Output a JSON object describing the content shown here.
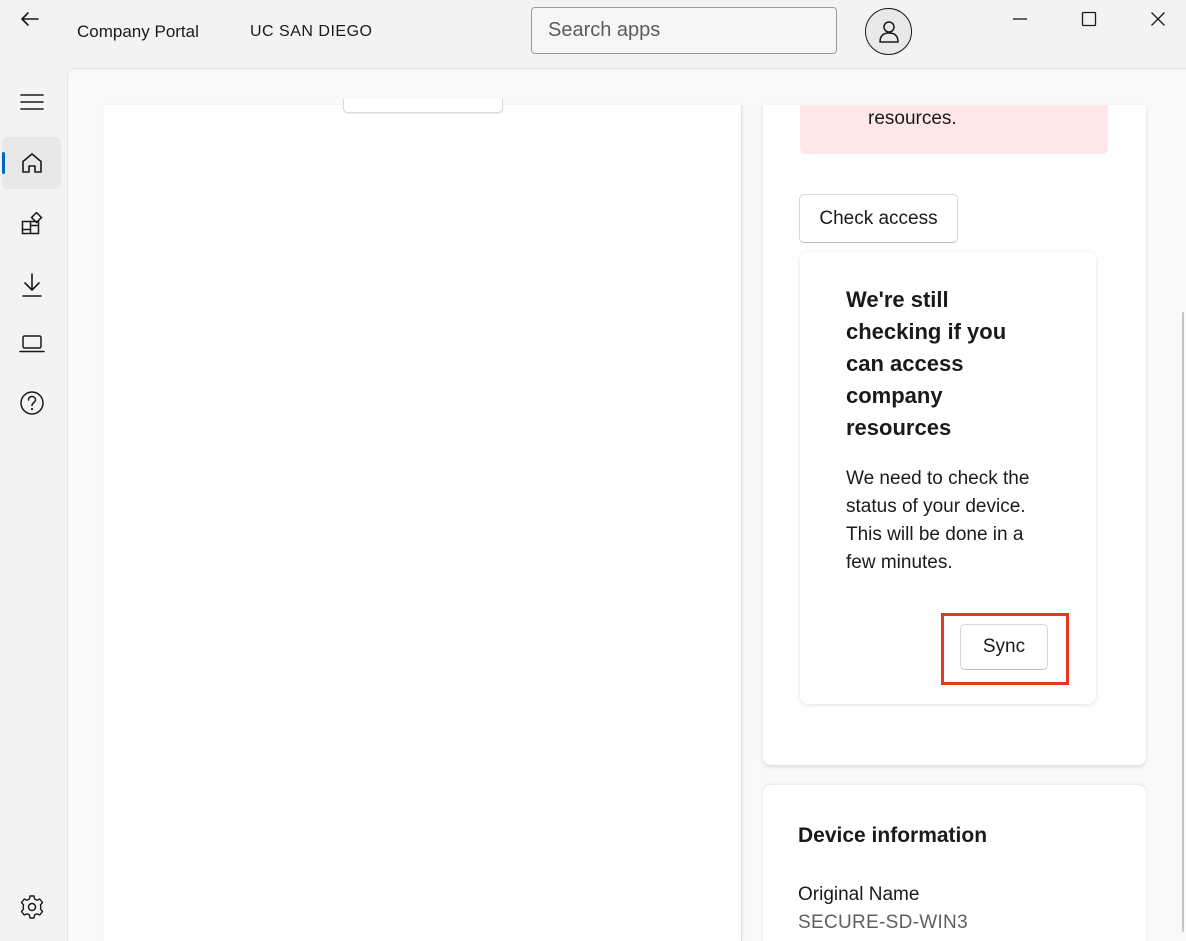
{
  "header": {
    "app_title": "Company Portal",
    "org_name": "UC SAN DIEGO",
    "search_placeholder": "Search apps"
  },
  "nav": {
    "items": [
      {
        "icon": "hamburger-menu-icon",
        "active": false
      },
      {
        "icon": "home-icon",
        "active": true
      },
      {
        "icon": "apps-icon",
        "active": false
      },
      {
        "icon": "download-icon",
        "active": false
      },
      {
        "icon": "laptop-icon",
        "active": false
      },
      {
        "icon": "help-icon",
        "active": false
      },
      {
        "icon": "settings-icon",
        "active": false
      }
    ]
  },
  "alert": {
    "text": "resources."
  },
  "actions": {
    "check_access_label": "Check access"
  },
  "status_card": {
    "title": "We're still checking if you can access company resources",
    "body": "We need to check the status of your device. This will be done in a few minutes.",
    "sync_label": "Sync"
  },
  "device_info": {
    "title": "Device information",
    "original_name_label": "Original Name",
    "original_name_value": "SECURE-SD-WIN3"
  },
  "colors": {
    "accent": "#0067c0",
    "alert_bg": "#fde7e9",
    "highlight": "#e8361f"
  }
}
